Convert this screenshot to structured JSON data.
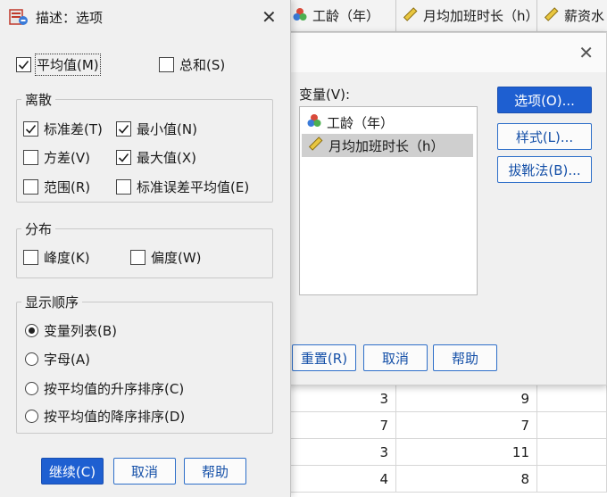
{
  "spreadsheet": {
    "headers": [
      {
        "label": "工龄（年）",
        "icon": "nominal-icon"
      },
      {
        "label": "月均加班时长（h）",
        "icon": "scale-ruler-icon"
      },
      {
        "label": "薪资水",
        "icon": "scale-ruler-icon"
      }
    ],
    "rows": [
      [
        "3",
        "9"
      ],
      [
        "7",
        "7"
      ],
      [
        "3",
        "11"
      ],
      [
        "4",
        "8"
      ]
    ]
  },
  "variables_dialog": {
    "variables_label": "变量(V):",
    "variables_label_key": "V",
    "variables": [
      {
        "name": "工龄（年）",
        "icon": "nominal-icon",
        "selected": false
      },
      {
        "name": "月均加班时长（h）",
        "icon": "scale-ruler-icon",
        "selected": true
      }
    ],
    "options_button": "选项(O)...",
    "style_button": "样式(L)...",
    "bootstrap_button": "拔靴法(B)...",
    "reset_button": "重置(R)",
    "cancel_button": "取消",
    "help_button": "帮助",
    "close_icon": "close-icon"
  },
  "options_dialog": {
    "title": "描述：选项",
    "close_icon": "close-icon",
    "mean": {
      "label": "平均值(M)",
      "checked": true
    },
    "sum": {
      "label": "总和(S)",
      "checked": false
    },
    "dispersion": {
      "title": "离散",
      "items": [
        {
          "label": "标准差(T)",
          "checked": true
        },
        {
          "label": "最小值(N)",
          "checked": true
        },
        {
          "label": "方差(V)",
          "checked": false
        },
        {
          "label": "最大值(X)",
          "checked": true
        },
        {
          "label": "范围(R)",
          "checked": false
        },
        {
          "label": "标准误差平均值(E)",
          "checked": false
        }
      ]
    },
    "distribution": {
      "title": "分布",
      "items": [
        {
          "label": "峰度(K)",
          "checked": false
        },
        {
          "label": "偏度(W)",
          "checked": false
        }
      ]
    },
    "display_order": {
      "title": "显示顺序",
      "items": [
        {
          "label": "变量列表(B)",
          "selected": true
        },
        {
          "label": "字母(A)",
          "selected": false
        },
        {
          "label": "按平均值的升序排序(C)",
          "selected": false
        },
        {
          "label": "按平均值的降序排序(D)",
          "selected": false
        }
      ]
    },
    "continue_button": "继续(C)",
    "cancel_button": "取消",
    "help_button": "帮助"
  },
  "colors": {
    "accent": "#1e5fd1",
    "dialog_bg": "#f0f0f0",
    "selected_row": "#cfcfcf"
  }
}
